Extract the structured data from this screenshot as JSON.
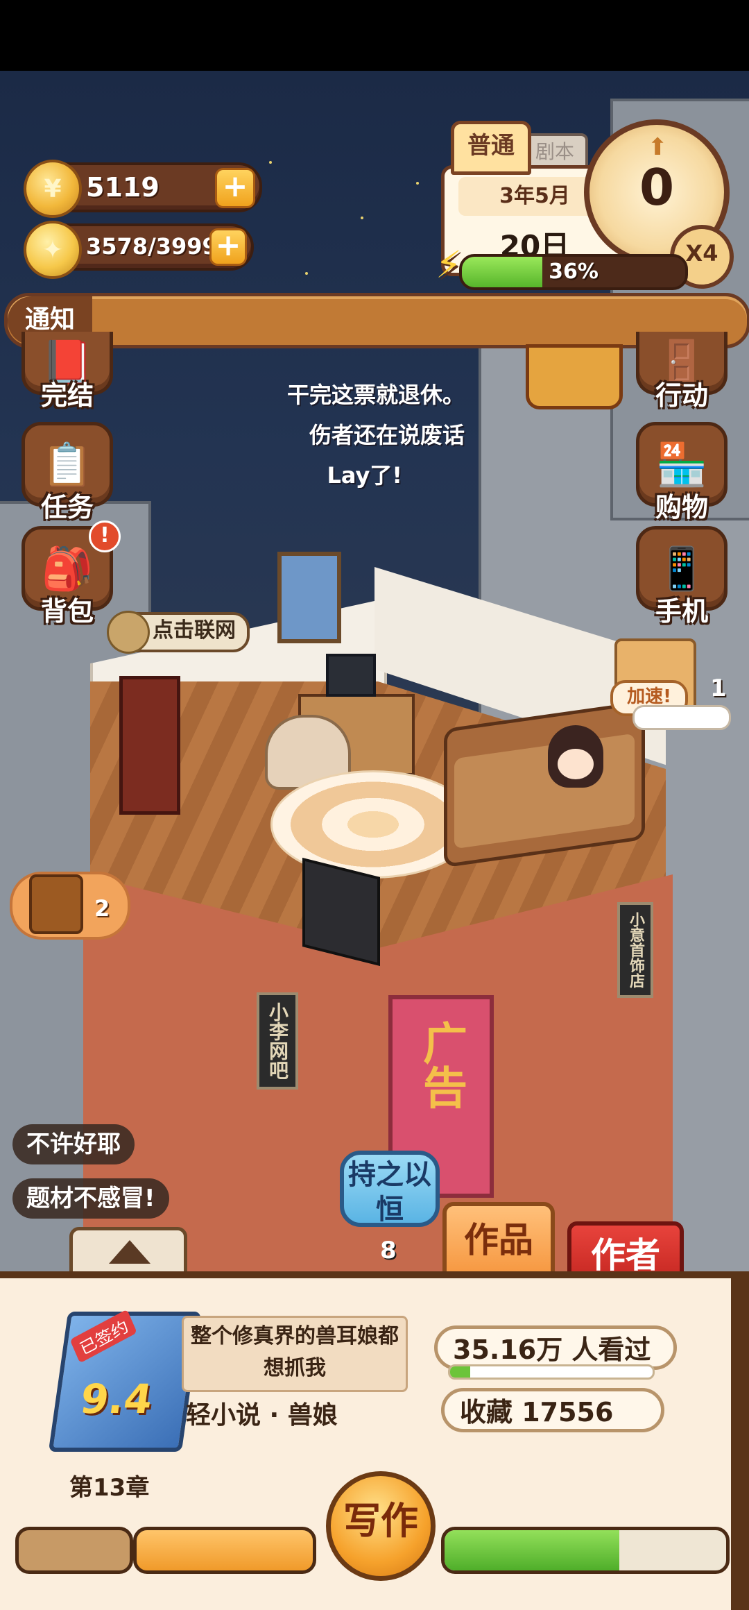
{
  "resources": {
    "coins": "5119",
    "energy": "3578/3999",
    "coin_icon": "coin-icon",
    "bulb_icon": "lightbulb-icon"
  },
  "calendar": {
    "tab_active": "普通",
    "tab_inactive": "剧本",
    "month": "3年5月",
    "day": "20日",
    "dial_value": "0",
    "speed": "X4",
    "energy_percent": "36%",
    "energy_fraction": 0.36
  },
  "notice": {
    "label": "通知"
  },
  "left_menu": [
    {
      "label": "完结",
      "icon": "book-icon"
    },
    {
      "label": "任务",
      "icon": "checklist-icon"
    },
    {
      "label": "背包",
      "icon": "backpack-icon",
      "badge": "!"
    }
  ],
  "right_menu": [
    {
      "label": "行动",
      "icon": "door-icon"
    },
    {
      "label": "购物",
      "icon": "shop-icon"
    },
    {
      "label": "手机",
      "icon": "phone-icon"
    }
  ],
  "dialogue": [
    "干完这票就退休。",
    "伤者还在说废话",
    "Lay了!"
  ],
  "network_bubble": "点击联网",
  "speedup": {
    "label": "加速!",
    "count": "1"
  },
  "chest": {
    "count": "2"
  },
  "chips": [
    "不许好耶",
    "题材不感冒!"
  ],
  "persist": {
    "label": "持之以恒",
    "count": "8"
  },
  "tabs": {
    "works": "作品",
    "author": "作者"
  },
  "book": {
    "signed": "已签约",
    "rating": "9.4",
    "title": "整个修真界的兽耳娘都想抓我",
    "genre": "轻小说 · 兽娘",
    "chapter": "第13章",
    "views": "35.16万 人看过",
    "views_fraction": 0.1,
    "favorites": "收藏 17556"
  },
  "write_button": "写作",
  "write_progress_fraction": 0.62,
  "shop_signs": [
    "小李网吧",
    "小意首饰店"
  ],
  "poster_text": "广告",
  "colors": {
    "wood": "#6b3a23",
    "accent": "#f0a21d",
    "green": "#57b52b"
  }
}
